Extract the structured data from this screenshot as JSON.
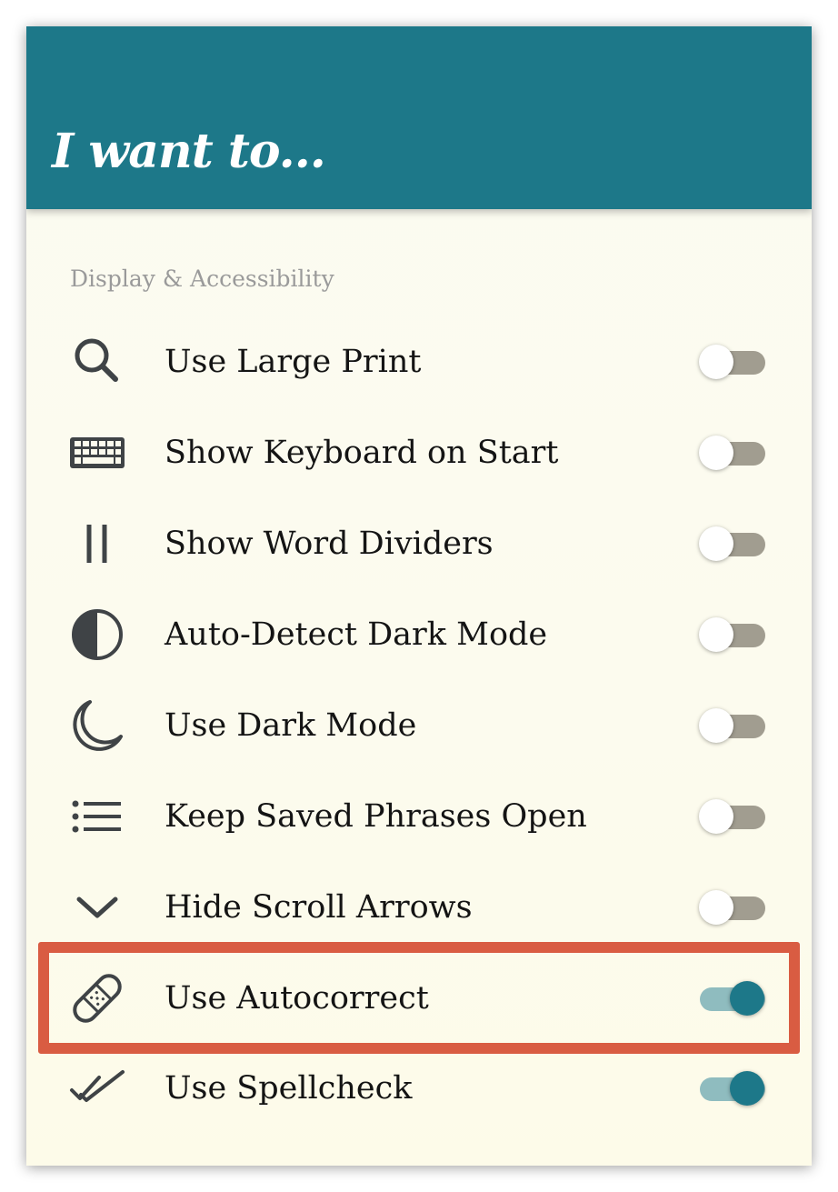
{
  "header": {
    "title": "I want to..."
  },
  "section": {
    "label": "Display & Accessibility"
  },
  "settings": [
    {
      "label": "Use Large Print",
      "icon": "magnifier-icon",
      "enabled": false
    },
    {
      "label": "Show Keyboard on Start",
      "icon": "keyboard-icon",
      "enabled": false
    },
    {
      "label": "Show Word Dividers",
      "icon": "word-divider-icon",
      "enabled": false
    },
    {
      "label": "Auto-Detect Dark Mode",
      "icon": "half-circle-contrast-icon",
      "enabled": false
    },
    {
      "label": "Use Dark Mode",
      "icon": "crescent-moon-icon",
      "enabled": false
    },
    {
      "label": "Keep Saved Phrases Open",
      "icon": "bulleted-list-icon",
      "enabled": false
    },
    {
      "label": "Hide Scroll Arrows",
      "icon": "chevron-down-icon",
      "enabled": false
    },
    {
      "label": "Use Autocorrect",
      "icon": "bandage-icon",
      "enabled": true,
      "highlighted": true
    },
    {
      "label": "Use Spellcheck",
      "icon": "double-check-icon",
      "enabled": true
    }
  ],
  "colors": {
    "header": "#1d7889",
    "toggle_on": "#1d7889",
    "toggle_off_track": "#a19d90",
    "highlight": "#d95c42",
    "background": "#fcfbee"
  }
}
